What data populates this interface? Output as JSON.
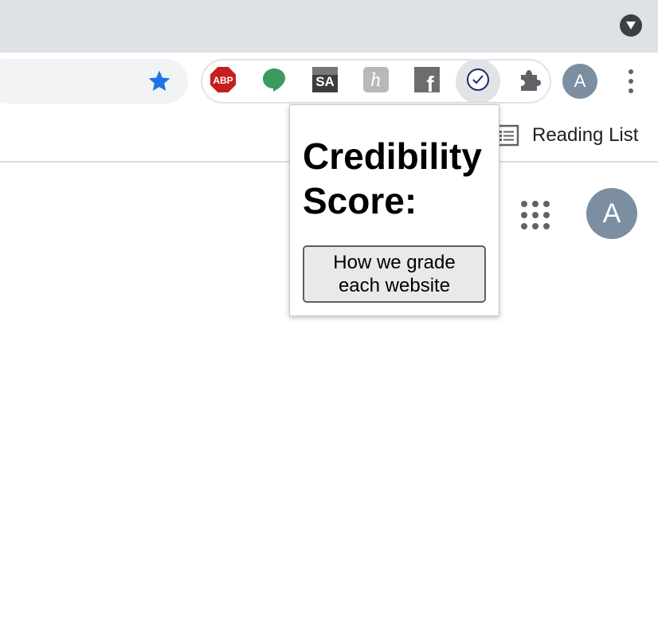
{
  "browser": {
    "tabstrip": {
      "menu_icon": "chevron-down-icon"
    },
    "toolbar": {
      "bookmark_icon": "star-icon",
      "extensions": [
        {
          "name": "adblock-plus",
          "label": "ABP",
          "color": "#c5201e"
        },
        {
          "name": "hangouts",
          "color": "#3a9b5c"
        },
        {
          "name": "seeking-alpha",
          "label": "SA",
          "color": "#3d3d3d"
        },
        {
          "name": "honey",
          "label": "h",
          "color": "#b8b8b8"
        },
        {
          "name": "facebook",
          "label": "f",
          "color": "#6d6d6d"
        },
        {
          "name": "credibility-checker",
          "color": "#1a2b6b"
        },
        {
          "name": "extensions-puzzle",
          "color": "#5f6368"
        }
      ],
      "profile_initial": "A",
      "menu_icon": "more-vert-icon"
    },
    "bookmarks_bar": {
      "reading_list_label": "Reading List",
      "reading_list_icon": "reading-list-icon"
    }
  },
  "page": {
    "apps_icon": "apps-grid-icon",
    "account_initial": "A"
  },
  "popup": {
    "title": "Credibility Score:",
    "button_label": "How we grade each website"
  },
  "colors": {
    "tabstrip_bg": "#dee1e6",
    "star_blue": "#1a73e8",
    "avatar_bg": "#7b8fa0"
  }
}
